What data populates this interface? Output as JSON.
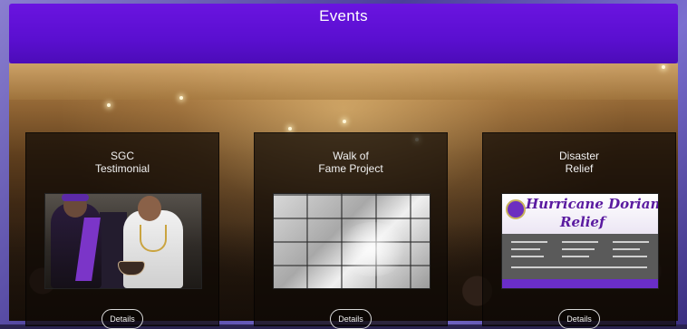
{
  "header": {
    "title": "Events"
  },
  "colors": {
    "header_purple": "#5a0fd0",
    "card_bg": "#0f0a06"
  },
  "cards": [
    {
      "title": "SGC\nTestimonial",
      "details_label": "Details"
    },
    {
      "title": "Walk of\nFame Project",
      "details_label": "Details"
    },
    {
      "title": "Disaster\nRelief",
      "details_label": "Details"
    }
  ],
  "flyer": {
    "title_line1": "Hurricane Dorian",
    "title_line2": "Relief"
  }
}
